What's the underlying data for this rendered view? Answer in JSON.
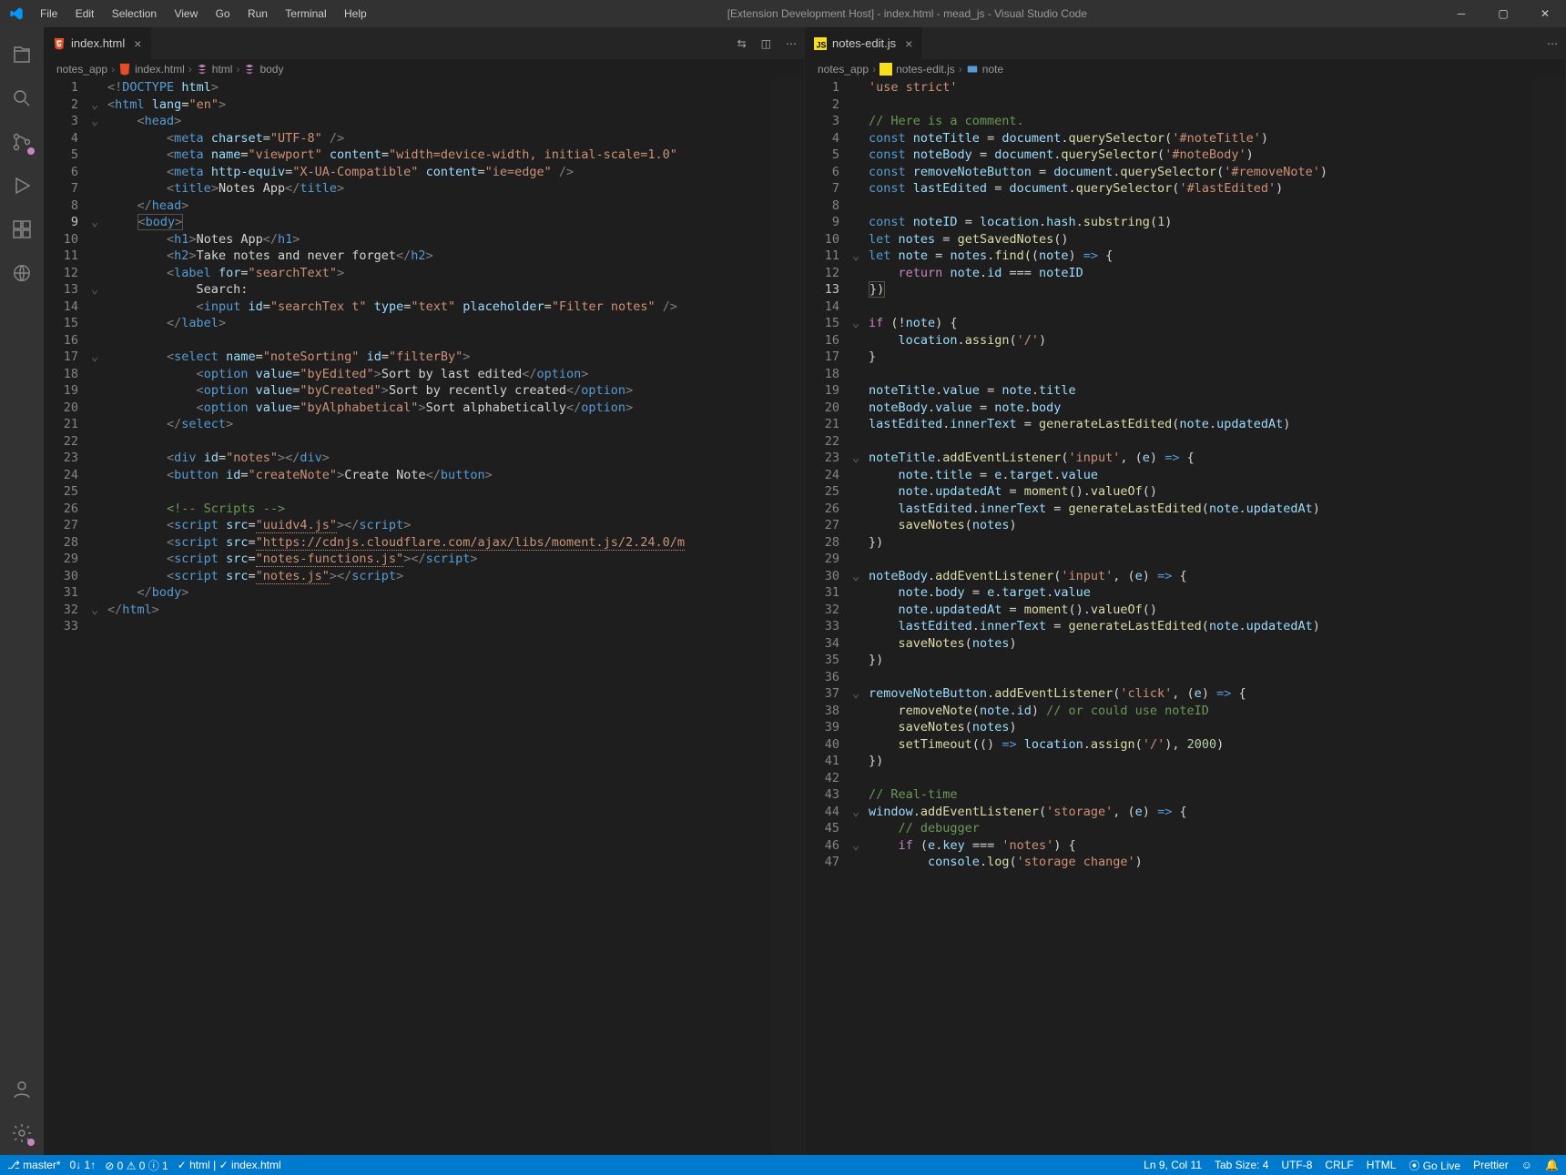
{
  "titlebar": {
    "title": "[Extension Development Host] - index.html - mead_js - Visual Studio Code",
    "menu": [
      "File",
      "Edit",
      "Selection",
      "View",
      "Go",
      "Run",
      "Terminal",
      "Help"
    ]
  },
  "tabs": {
    "left": {
      "filename": "index.html"
    },
    "right": {
      "filename": "notes-edit.js"
    }
  },
  "crumbs": {
    "left": [
      "notes_app",
      "index.html",
      "html",
      "body"
    ],
    "right": [
      "notes_app",
      "notes-edit.js",
      "note"
    ]
  },
  "status": {
    "branch": "master*",
    "sync": "0↓ 1↑",
    "errors": "⊘ 0 ⚠ 0 ⓘ 1",
    "lang_check": "✓ html | ✓ index.html",
    "lncol": "Ln 9, Col 11",
    "tabsize": "Tab Size: 4",
    "enc": "UTF-8",
    "eol": "CRLF",
    "lang": "HTML",
    "golive": "⦿ Go Live",
    "prettier": "Prettier"
  },
  "code_left_count": 33,
  "code_right_count": 47
}
